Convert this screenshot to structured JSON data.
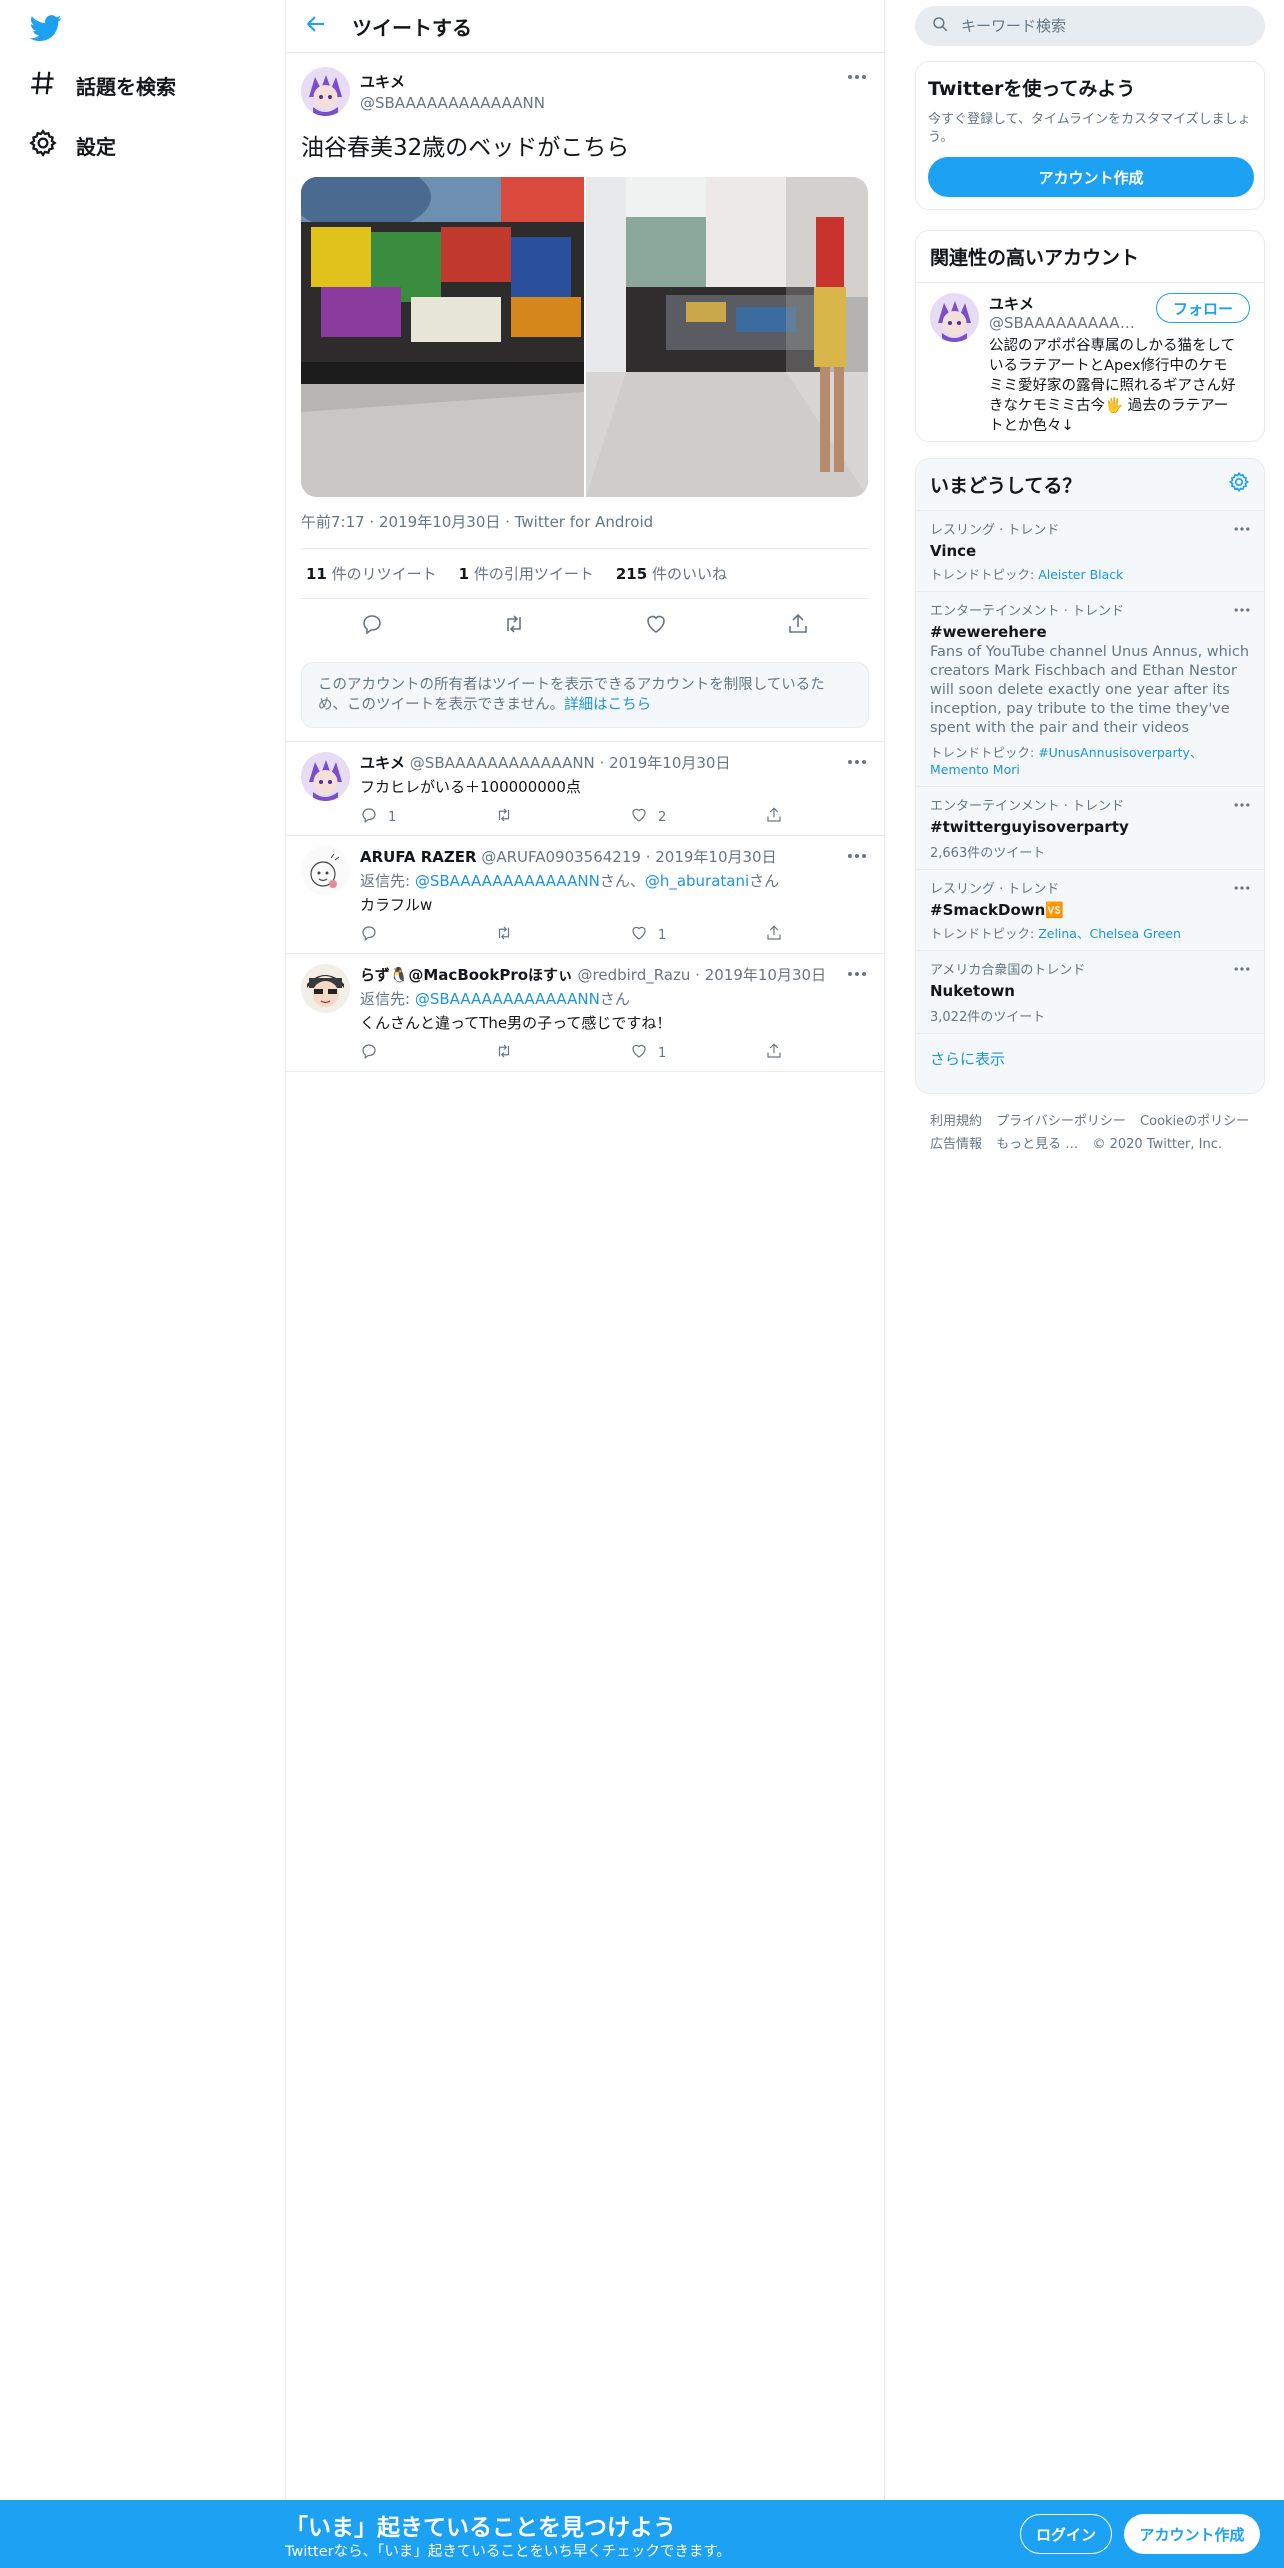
{
  "nav": {
    "items": [
      {
        "label": "話題を検索",
        "icon": "hashtag-icon"
      },
      {
        "label": "設定",
        "icon": "gear-icon"
      }
    ]
  },
  "header": {
    "title": "ツイートする"
  },
  "main_tweet": {
    "author_name": "ユキメ",
    "author_handle": "@SBAAAAAAAAAAAANN",
    "text": "油谷春美32歳のベッドがこちら",
    "time": "午前7:17",
    "date": "2019年10月30日",
    "client": "Twitter for Android",
    "retweets_count": "11",
    "retweets_label": " 件のリツイート",
    "quotes_count": "1",
    "quotes_label": " 件の引用ツイート",
    "likes_count": "215",
    "likes_label": " 件のいいね"
  },
  "protected_notice": {
    "text": "このアカウントの所有者はツイートを表示できるアカウントを制限しているため、このツイートを表示できません。",
    "link": "詳細はこちら"
  },
  "replies": [
    {
      "name": "ユキメ",
      "handle": "@SBAAAAAAAAAAAANN",
      "date": "2019年10月30日",
      "reply_to_label": "",
      "text": "フカヒレがいる＋100000000点",
      "reply_count": "1",
      "retweet_count": "",
      "like_count": "2"
    },
    {
      "name": "ARUFA RAZER",
      "handle": "@ARUFA0903564219",
      "date": "2019年10月30日",
      "reply_to_label": "返信先: ",
      "reply_to_1": "@SBAAAAAAAAAAAANN",
      "reply_to_sep": "さん、",
      "reply_to_2": "@h_aburatani",
      "reply_to_end": "さん",
      "text": "カラフルw",
      "reply_count": "",
      "retweet_count": "",
      "like_count": "1"
    },
    {
      "name": "らず🐧@MacBookProほすぃ",
      "handle": "@redbird_Razu",
      "date": "2019年10月30日",
      "reply_to_label": "返信先: ",
      "reply_to_1": "@SBAAAAAAAAAAAANN",
      "reply_to_end": "さん",
      "text": "くんさんと違ってThe男の子って感じですね！",
      "reply_count": "",
      "retweet_count": "",
      "like_count": "1"
    }
  ],
  "search": {
    "placeholder": "キーワード検索"
  },
  "signup_card": {
    "title": "Twitterを使ってみよう",
    "text": "今すぐ登録して、タイムラインをカスタマイズしましょう。",
    "button": "アカウント作成"
  },
  "related": {
    "title": "関連性の高いアカウント",
    "name": "ユキメ",
    "handle": "@SBAAAAAAAAAAAANN",
    "follow": "フォロー",
    "bio": "公認のアポポ谷専属のしかる猫をしているラテアートとApex修行中のケモミミ愛好家の露骨に照れるギアさん好きなケモミミ古今🖐 過去のラテアートとか色々↓"
  },
  "trends": {
    "title": "いまどうしてる？",
    "items": [
      {
        "category": "レスリング · トレンド",
        "name": "Vince",
        "topic_label": "トレンドトピック: ",
        "topic": "Aleister Black"
      },
      {
        "category": "エンターテインメント · トレンド",
        "name": "#wewerehere",
        "desc": "Fans of YouTube channel Unus Annus, which creators Mark Fischbach and Ethan Nestor will soon delete exactly one year after its inception, pay tribute to the time they've spent with the pair and their videos",
        "topic_label": "トレンドトピック: ",
        "topic": "#UnusAnnusisoverparty、Memento Mori"
      },
      {
        "category": "エンターテインメント · トレンド",
        "name": "#twitterguyisoverparty",
        "count": "2,663件のツイート"
      },
      {
        "category": "レスリング · トレンド",
        "name": "#SmackDown🆚",
        "topic_label": "トレンドトピック: ",
        "topic": "Zelina、Chelsea Green"
      },
      {
        "category": "アメリカ合衆国のトレンド",
        "name": "Nuketown",
        "count": "3,022件のツイート"
      }
    ],
    "show_more": "さらに表示"
  },
  "footer": {
    "links": [
      "利用規約",
      "プライバシーポリシー",
      "Cookieのポリシー",
      "広告情報",
      "もっと見る …",
      "© 2020 Twitter, Inc."
    ]
  },
  "bottom_bar": {
    "title": "「いま」起きていることを見つけよう",
    "subtitle": "Twitterなら、「いま」起きていることをいち早くチェックできます。",
    "login": "ログイン",
    "signup": "アカウント作成"
  },
  "colors": {
    "accent": "#1da1f2",
    "link": "#1b95e0",
    "muted": "#657786",
    "border": "#e6ecf0"
  }
}
